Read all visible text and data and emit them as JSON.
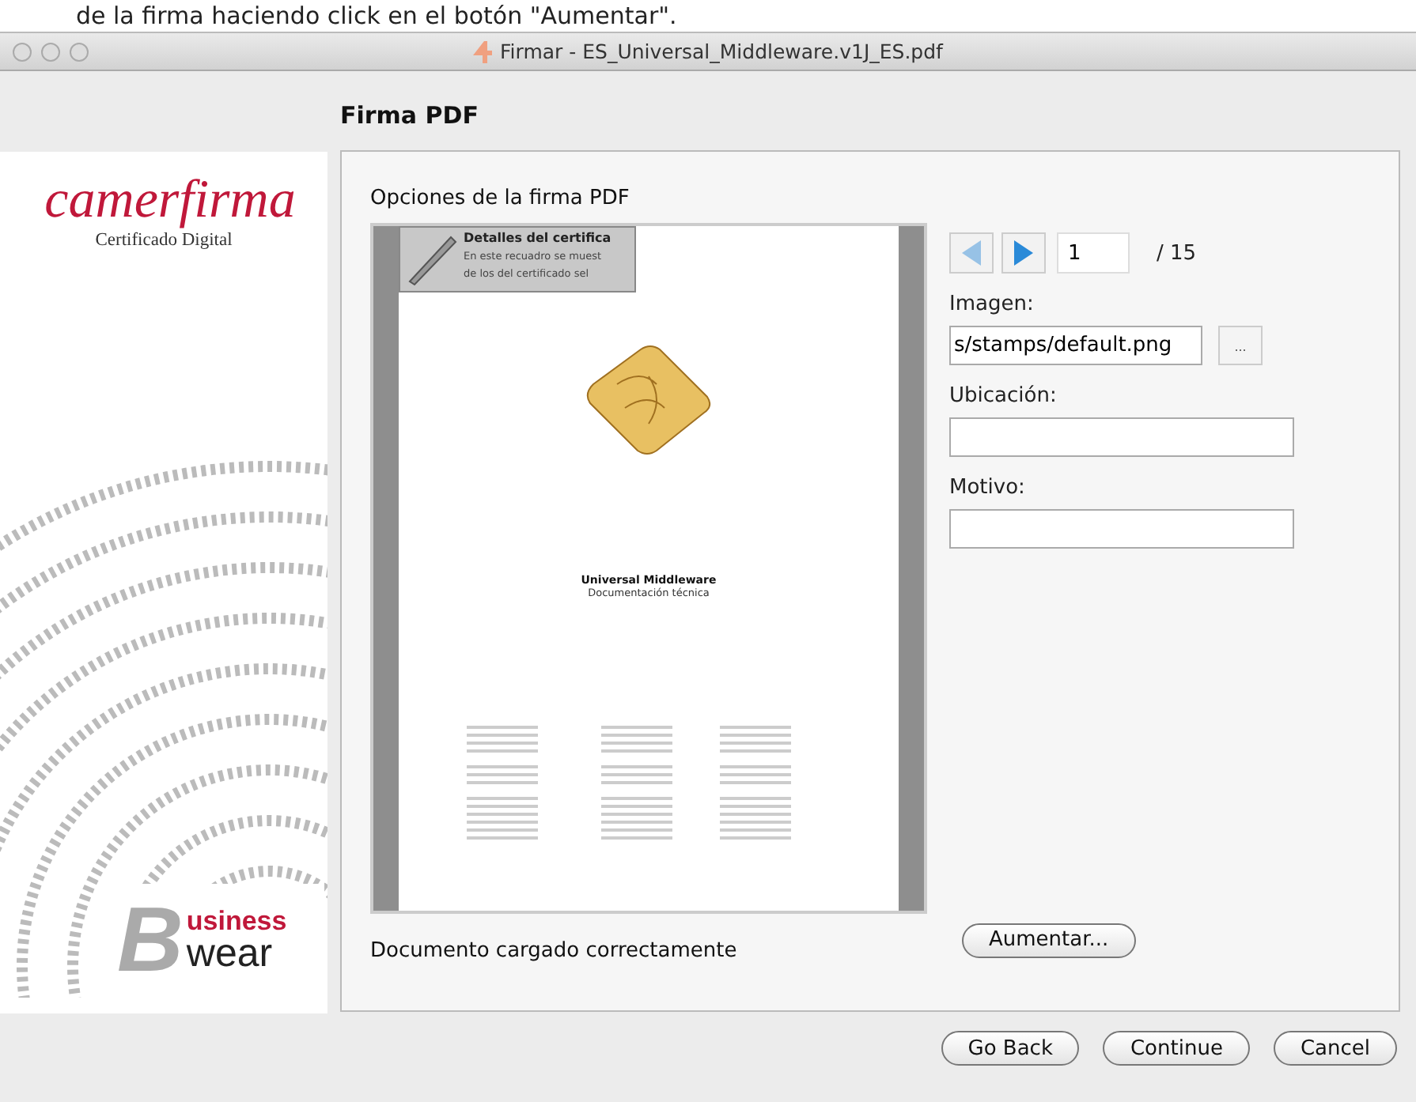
{
  "caption_fragment": "de la firma haciendo click en el botón \"Aumentar\".",
  "window": {
    "title": "Firmar - ES_Universal_Middleware.v1J_ES.pdf"
  },
  "header": {
    "title": "Firma PDF"
  },
  "branding": {
    "logo": "camerfirma",
    "tagline": "Certificado Digital",
    "badge_letter": "B",
    "badge_line1": "usiness",
    "badge_line2": "wear"
  },
  "panel": {
    "title": "Opciones de la firma PDF",
    "preview": {
      "stamp_title": "Detalles del certifica",
      "stamp_text": "En este recuadro se muest",
      "stamp_text2": "de los del certificado sel",
      "doc_title": "Universal Middleware",
      "doc_subtitle": "Documentación técnica"
    },
    "pager": {
      "prev_disabled": true,
      "next_disabled": false,
      "page": "1",
      "total": "/ 15"
    },
    "fields": [
      {
        "label": "Imagen:",
        "value": "s/stamps/default.png",
        "browse": "..."
      },
      {
        "label": "Ubicación:"
      },
      {
        "label": "Motivo:"
      }
    ],
    "enlarge_button": "Aumentar...",
    "status": "Documento cargado correctamente"
  },
  "buttons": [
    "Go Back",
    "Continue",
    "Cancel"
  ]
}
